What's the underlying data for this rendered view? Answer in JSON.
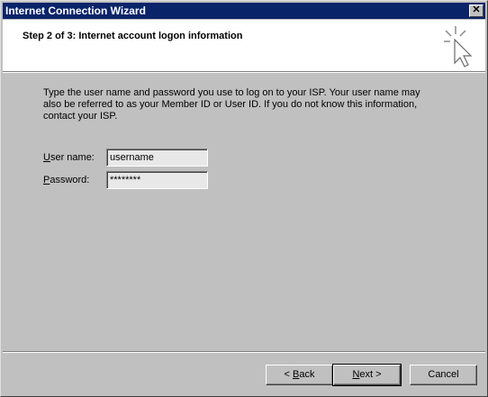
{
  "window": {
    "title": "Internet Connection Wizard"
  },
  "header": {
    "step_title": "Step 2 of 3: Internet account logon information"
  },
  "main": {
    "description": "Type the user name and password you use to log on to your ISP. Your user name may also be referred to as your Member ID or User ID. If you do not know this information, contact your ISP.",
    "username_label": {
      "accel": "U",
      "rest": "ser name:"
    },
    "username_value": "username",
    "password_label": {
      "accel": "P",
      "rest": "assword:"
    },
    "password_value": "********"
  },
  "footer": {
    "back": {
      "prefix": "< ",
      "accel": "B",
      "rest": "ack"
    },
    "next": {
      "accel": "N",
      "rest": "ext >"
    },
    "cancel": "Cancel"
  },
  "icons": {
    "close": "close-icon",
    "wizard": "wizard-cursor-icon"
  },
  "colors": {
    "titlebar": "#0a246a",
    "face": "#c0c0c0",
    "header_bg": "#ffffff"
  }
}
